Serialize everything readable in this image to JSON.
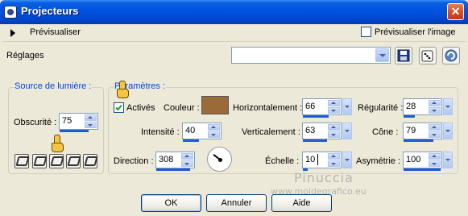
{
  "window": {
    "title": "Projecteurs",
    "close_glyph": "✕",
    "title_bar_color": "#0054e3",
    "background": "#ece9d8"
  },
  "preview": {
    "toggle_label": "Prévisualiser",
    "image_checkbox_label": "Prévisualiser l'image",
    "image_checkbox_checked": false
  },
  "settings": {
    "label": "Réglages",
    "preset_value": "",
    "tool_icons": [
      "save-icon",
      "dice-icon",
      "reset-icon"
    ]
  },
  "light_source": {
    "legend": "Source de lumière :",
    "obscurity_label": "Obscurité :",
    "obscurity_value": "75",
    "light_icons_count": 5
  },
  "params": {
    "legend": "Paramètres :",
    "active_label": "Activés",
    "active_checked": true,
    "color_label": "Couleur :",
    "color_value": "#9a6a3a",
    "intensity_label": "Intensité :",
    "intensity_value": "40",
    "direction_label": "Direction :",
    "direction_value": "308",
    "horizontal_label": "Horizontalement :",
    "horizontal_value": "66",
    "vertical_label": "Verticalement :",
    "vertical_value": "63",
    "scale_label": "Échelle :",
    "scale_value": "10",
    "regularity_label": "Régularité :",
    "regularity_value": "28",
    "cone_label": "Cône :",
    "cone_value": "79",
    "asymmetry_label": "Asymétrie :",
    "asymmetry_value": "100"
  },
  "buttons": {
    "ok": "OK",
    "cancel": "Annuler",
    "help": "Aide"
  },
  "watermark": {
    "line1": "Pinuccia",
    "line2": "www.moidegrafico.eu"
  }
}
